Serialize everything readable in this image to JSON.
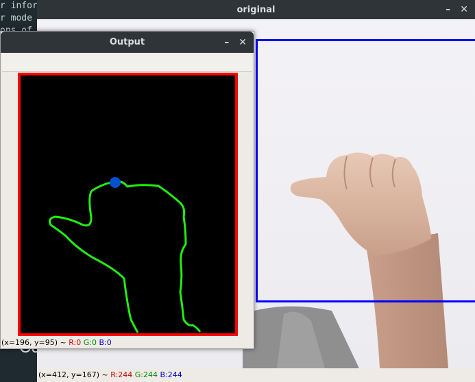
{
  "terminal": {
    "lines": [
      "r infor",
      "r mode",
      "ons of"
    ],
    "large_text": "Co"
  },
  "original_window": {
    "title": "original",
    "controls": {
      "minimize": "–",
      "close": "✕"
    },
    "status": {
      "coords": "(x=412, y=167) ~",
      "r": "R:244",
      "g": "G:244",
      "b": "B:244"
    },
    "roi_color": "#0000ff"
  },
  "output_window": {
    "title": "Output",
    "controls": {
      "minimize": "–",
      "close": "✕"
    },
    "status": {
      "coords": "(x=196, y=95) ~",
      "r": "R:0",
      "g": "G:0",
      "b": "B:0"
    },
    "border_color": "#ff0000",
    "contour_color": "#00ff00",
    "point_color": "#0050d0"
  }
}
